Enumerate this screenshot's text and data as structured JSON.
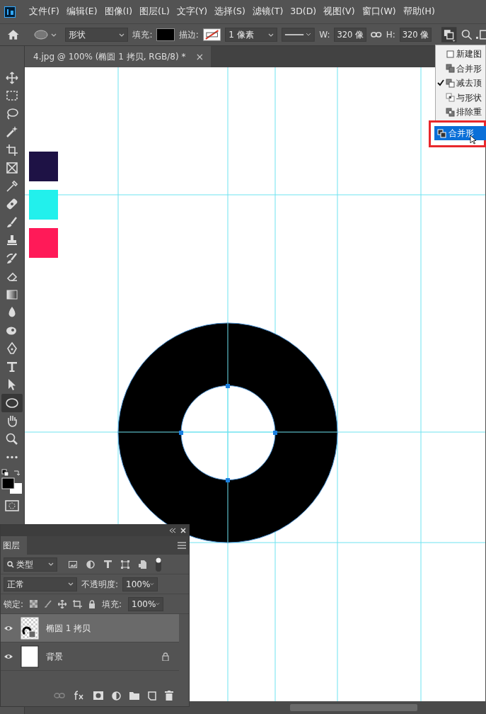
{
  "menu_bar": {
    "items": [
      "文件(F)",
      "编辑(E)",
      "图像(I)",
      "图层(L)",
      "文字(Y)",
      "选择(S)",
      "滤镜(T)",
      "3D(D)",
      "视图(V)",
      "窗口(W)",
      "帮助(H)"
    ]
  },
  "options_bar": {
    "mode": "形状",
    "fill_label": "填充:",
    "stroke_label": "描边:",
    "stroke_width": "1 像素",
    "w_label": "W:",
    "w_value": "320 像",
    "h_label": "H:",
    "h_value": "320 像"
  },
  "document_tab": {
    "title": "4.jpg @ 100% (椭圆 1 拷贝, RGB/8) *",
    "close": "×"
  },
  "tools": [
    {
      "kind": "move",
      "selected": false
    },
    {
      "kind": "marquee",
      "selected": false
    },
    {
      "kind": "lasso",
      "selected": false
    },
    {
      "kind": "wand",
      "selected": false
    },
    {
      "kind": "crop",
      "selected": false
    },
    {
      "kind": "frame",
      "selected": false
    },
    {
      "kind": "eyedropper",
      "selected": false
    },
    {
      "kind": "healing",
      "selected": false
    },
    {
      "kind": "brush",
      "selected": false
    },
    {
      "kind": "stamp",
      "selected": false
    },
    {
      "kind": "history",
      "selected": false
    },
    {
      "kind": "eraser",
      "selected": false
    },
    {
      "kind": "gradient",
      "selected": false
    },
    {
      "kind": "blur",
      "selected": false
    },
    {
      "kind": "dodge",
      "selected": false
    },
    {
      "kind": "pen",
      "selected": false
    },
    {
      "kind": "type",
      "selected": false
    },
    {
      "kind": "select",
      "selected": false
    },
    {
      "kind": "ellipse",
      "selected": true
    },
    {
      "kind": "hand",
      "selected": false
    },
    {
      "kind": "zoom",
      "selected": false
    },
    {
      "kind": "more",
      "selected": false
    }
  ],
  "swatches": [
    {
      "color": "#1e1245"
    },
    {
      "color": "#22f0ec"
    },
    {
      "color": "#ff1a58"
    }
  ],
  "path_ops_menu": {
    "items": [
      {
        "label": "新建图",
        "kind": "new",
        "checked": false
      },
      {
        "label": "合并形",
        "kind": "combine",
        "checked": false
      },
      {
        "label": "减去顶",
        "kind": "subtract",
        "checked": true
      },
      {
        "label": "与形状",
        "kind": "intersect",
        "checked": false
      },
      {
        "label": "排除重",
        "kind": "exclude",
        "checked": false
      }
    ],
    "highlighted_item": {
      "label": "合并形"
    }
  },
  "layers_panel": {
    "tab": "图层",
    "filter": "类型",
    "blend_mode": "正常",
    "opacity_label": "不透明度:",
    "opacity": "100%",
    "lock_label": "锁定:",
    "fill_label": "填充:",
    "fill": "100%",
    "layers": [
      {
        "name": "椭圆 1 拷贝",
        "kind": "shape",
        "selected": true,
        "visible": true,
        "locked": false
      },
      {
        "name": "背景",
        "kind": "background",
        "selected": false,
        "visible": true,
        "locked": true
      }
    ]
  }
}
